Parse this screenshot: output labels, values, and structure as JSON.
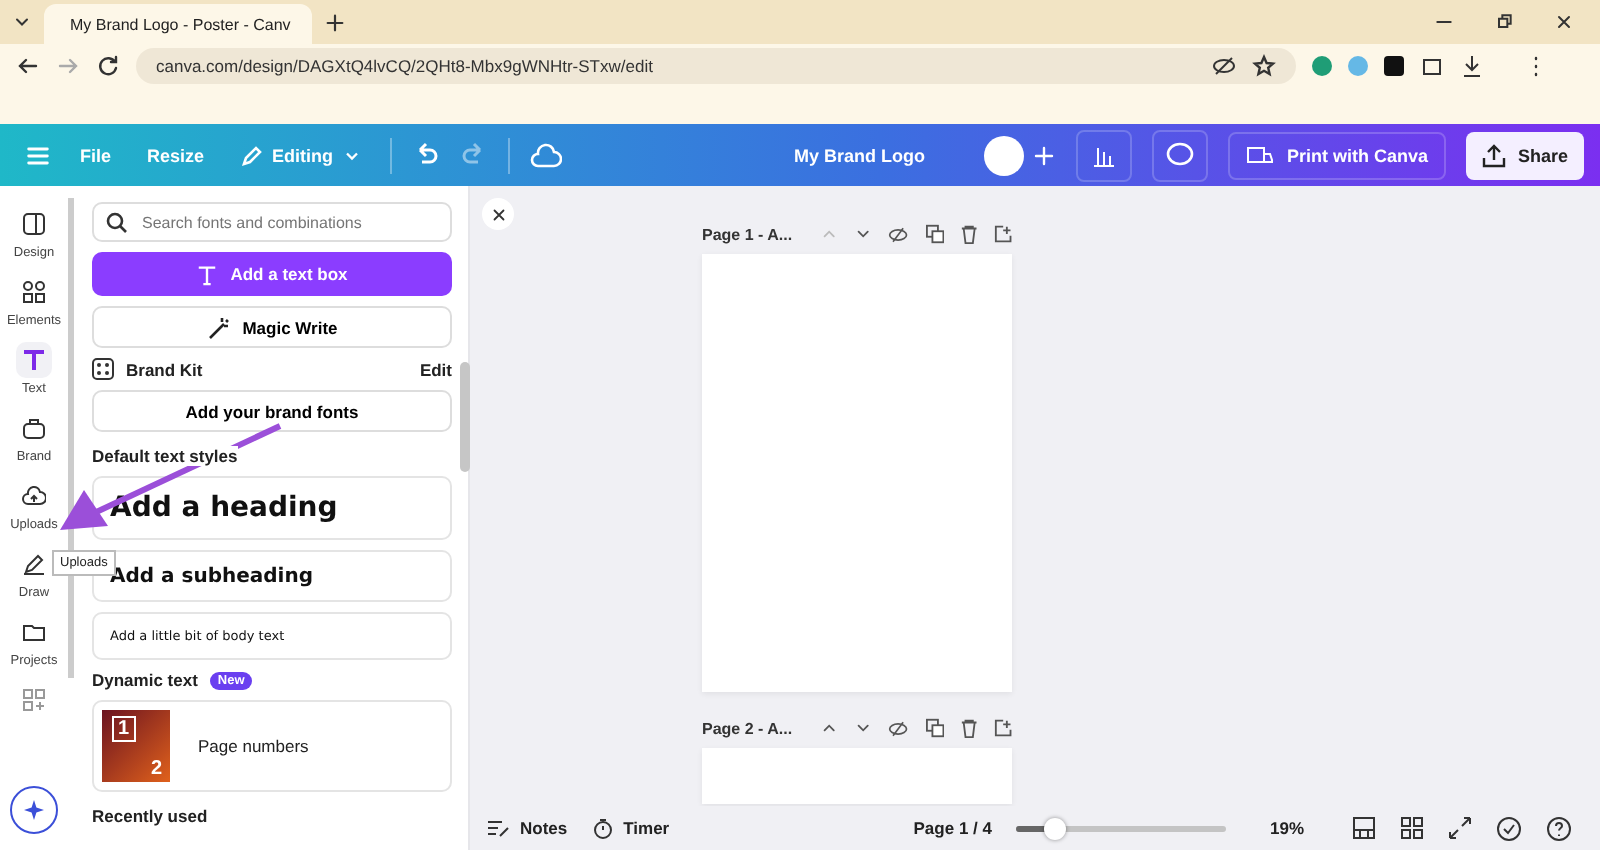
{
  "browser": {
    "tab_title": "My Brand Logo - Poster - Canv",
    "url": "canva.com/design/DAGXtQ4lvCQ/2QHt8-Mbx9gWNHtr-STxw/edit"
  },
  "toolbar": {
    "items": [
      {
        "label": "File"
      },
      {
        "label": "Resize"
      },
      {
        "label": "Editing"
      }
    ],
    "title": "My Brand Logo",
    "print": "Print with Canva",
    "share": "Share"
  },
  "rail": [
    {
      "label": "Design",
      "selected": false
    },
    {
      "label": "Elements",
      "selected": false
    },
    {
      "label": "Text",
      "selected": true
    },
    {
      "label": "Brand",
      "selected": false
    },
    {
      "label": "Uploads",
      "selected": false
    },
    {
      "label": "Draw",
      "selected": false
    },
    {
      "label": "Projects",
      "selected": false
    },
    {
      "selected": false
    }
  ],
  "tooltip": "Uploads",
  "panel": {
    "search_placeholder": "Search fonts and combinations",
    "add_text_box": "Add a text box",
    "magic_write": "Magic Write",
    "brand_kit": "Brand Kit",
    "edit": "Edit",
    "add_brand_fonts": "Add your brand fonts",
    "default_styles_heading": "Default text styles",
    "styles": [
      {
        "kind": "heading",
        "label": "Add a heading"
      },
      {
        "kind": "subheading",
        "label": "Add a subheading"
      },
      {
        "kind": "body",
        "label": "Add a little bit of body text"
      }
    ],
    "dynamic_heading": "Dynamic text",
    "new_badge": "New",
    "page_numbers": "Page numbers",
    "thumb_digits": [
      "1",
      "2"
    ],
    "recently_used": "Recently used"
  },
  "pages": [
    {
      "label": "Page 1 - A..."
    },
    {
      "label": "Page 2 - A..."
    }
  ],
  "footer": {
    "notes": "Notes",
    "timer": "Timer",
    "page_count": "Page 1 / 4",
    "zoom": {
      "level": 0.18
    },
    "zoom_reading": "19%"
  }
}
